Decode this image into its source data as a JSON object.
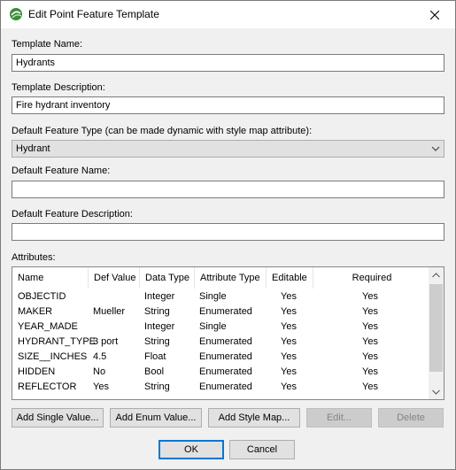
{
  "window": {
    "title": "Edit Point Feature Template",
    "app_icon": "globe-icon",
    "close_icon": "close-icon"
  },
  "template_name": {
    "label": "Template Name:",
    "value": "Hydrants"
  },
  "template_description": {
    "label": "Template Description:",
    "value": "Fire hydrant inventory"
  },
  "feature_type": {
    "label": "Default Feature Type (can be made dynamic with style map attribute):",
    "selected": "Hydrant"
  },
  "feature_name": {
    "label": "Default Feature Name:",
    "value": ""
  },
  "feature_description": {
    "label": "Default Feature Description:",
    "value": ""
  },
  "attributes": {
    "label": "Attributes:",
    "columns": [
      "Name",
      "Def Value",
      "Data Type",
      "Attribute Type",
      "Editable",
      "Required"
    ],
    "rows": [
      [
        "OBJECTID",
        "",
        "Integer",
        "Single",
        "Yes",
        "Yes"
      ],
      [
        "MAKER",
        "Mueller",
        "String",
        "Enumerated",
        "Yes",
        "Yes"
      ],
      [
        "YEAR_MADE",
        "",
        "Integer",
        "Single",
        "Yes",
        "Yes"
      ],
      [
        "HYDRANT_TYPE",
        "3 port",
        "String",
        "Enumerated",
        "Yes",
        "Yes"
      ],
      [
        "SIZE__INCHES",
        "4.5",
        "Float",
        "Enumerated",
        "Yes",
        "Yes"
      ],
      [
        "HIDDEN",
        "No",
        "Bool",
        "Enumerated",
        "Yes",
        "Yes"
      ],
      [
        "REFLECTOR",
        "Yes",
        "String",
        "Enumerated",
        "Yes",
        "Yes"
      ]
    ]
  },
  "buttons": {
    "add_single": "Add Single Value...",
    "add_enum": "Add Enum Value...",
    "add_style_map": "Add Style Map...",
    "edit": "Edit...",
    "delete": "Delete",
    "ok": "OK",
    "cancel": "Cancel"
  },
  "colors": {
    "accent": "#0078d7",
    "dialog_bg": "#f0f0f0",
    "disabled_text": "#838383"
  }
}
